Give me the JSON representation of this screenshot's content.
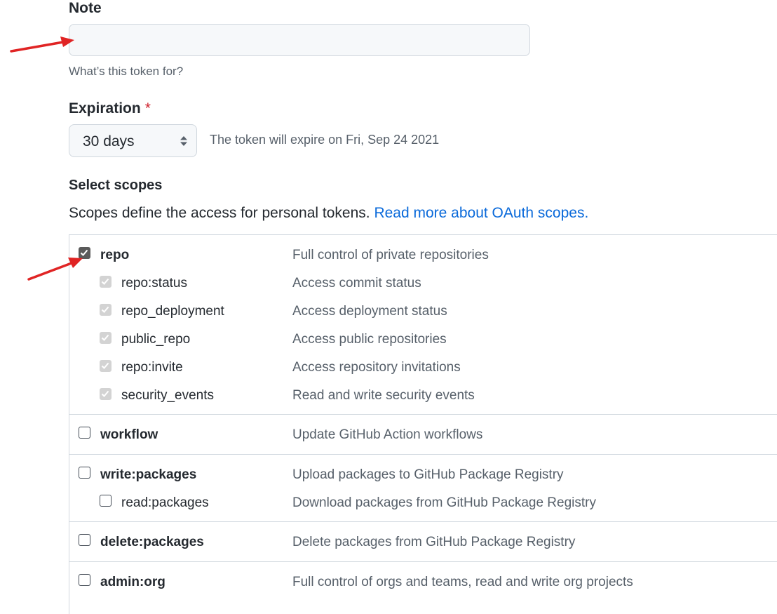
{
  "note": {
    "label": "Note",
    "value": "",
    "placeholder": "",
    "hint": "What’s this token for?"
  },
  "expiration": {
    "label": "Expiration",
    "required_mark": "*",
    "selected": "30 days",
    "expire_text": "The token will expire on Fri, Sep 24 2021"
  },
  "scopes": {
    "title": "Select scopes",
    "description": "Scopes define the access for personal tokens.",
    "link_text": "Read more about OAuth scopes.",
    "groups": [
      {
        "name": "repo",
        "description": "Full control of private repositories",
        "checked": true,
        "children": [
          {
            "name": "repo:status",
            "description": "Access commit status",
            "checked": true
          },
          {
            "name": "repo_deployment",
            "description": "Access deployment status",
            "checked": true
          },
          {
            "name": "public_repo",
            "description": "Access public repositories",
            "checked": true
          },
          {
            "name": "repo:invite",
            "description": "Access repository invitations",
            "checked": true
          },
          {
            "name": "security_events",
            "description": "Read and write security events",
            "checked": true
          }
        ]
      },
      {
        "name": "workflow",
        "description": "Update GitHub Action workflows",
        "checked": false,
        "children": []
      },
      {
        "name": "write:packages",
        "description": "Upload packages to GitHub Package Registry",
        "checked": false,
        "children": [
          {
            "name": "read:packages",
            "description": "Download packages from GitHub Package Registry",
            "checked": false
          }
        ]
      },
      {
        "name": "delete:packages",
        "description": "Delete packages from GitHub Package Registry",
        "checked": false,
        "children": []
      },
      {
        "name": "admin:org",
        "description": "Full control of orgs and teams, read and write org projects",
        "checked": false,
        "children": []
      }
    ]
  },
  "colors": {
    "annotation_arrow": "#e02424",
    "link": "#0969da",
    "required": "#cf222e"
  },
  "icons": {
    "select_caret": "up-down-caret-icon",
    "annotation": "red-arrow-icon"
  }
}
